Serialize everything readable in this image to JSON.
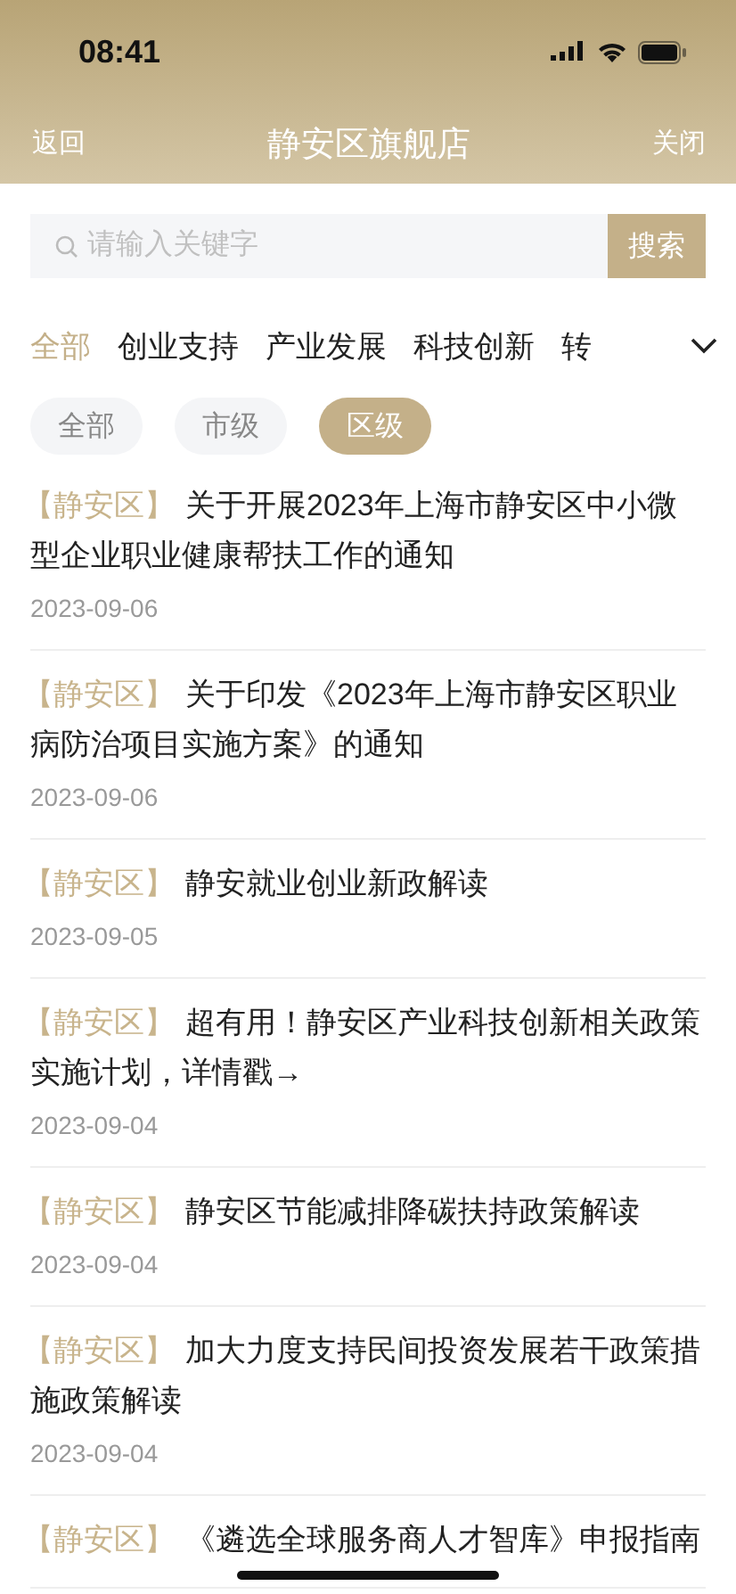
{
  "status_bar": {
    "time": "08:41"
  },
  "nav": {
    "back": "返回",
    "title": "静安区旗舰店",
    "close": "关闭"
  },
  "search": {
    "placeholder": "请输入关键字",
    "button": "搜索"
  },
  "categories": [
    {
      "label": "全部",
      "selected": true
    },
    {
      "label": "创业支持",
      "selected": false
    },
    {
      "label": "产业发展",
      "selected": false
    },
    {
      "label": "科技创新",
      "selected": false
    },
    {
      "label": "转",
      "selected": false
    }
  ],
  "levels": [
    {
      "label": "全部",
      "selected": false
    },
    {
      "label": "市级",
      "selected": false
    },
    {
      "label": "区级",
      "selected": true
    }
  ],
  "articles": [
    {
      "tag": "【静安区】",
      "title": "关于开展2023年上海市静安区中小微型企业职业健康帮扶工作的通知",
      "date": "2023-09-06"
    },
    {
      "tag": "【静安区】",
      "title": "关于印发《2023年上海市静安区职业病防治项目实施方案》的通知",
      "date": "2023-09-06"
    },
    {
      "tag": "【静安区】",
      "title": "静安就业创业新政解读",
      "date": "2023-09-05"
    },
    {
      "tag": "【静安区】",
      "title": "超有用！静安区产业科技创新相关政策实施计划，详情戳→",
      "date": "2023-09-04"
    },
    {
      "tag": "【静安区】",
      "title": "静安区节能减排降碳扶持政策解读",
      "date": "2023-09-04"
    },
    {
      "tag": "【静安区】",
      "title": "加大力度支持民间投资发展若干政策措施政策解读",
      "date": "2023-09-04"
    },
    {
      "tag": "【静安区】",
      "title": "《遴选全球服务商人才智库》申报指南"
    }
  ]
}
